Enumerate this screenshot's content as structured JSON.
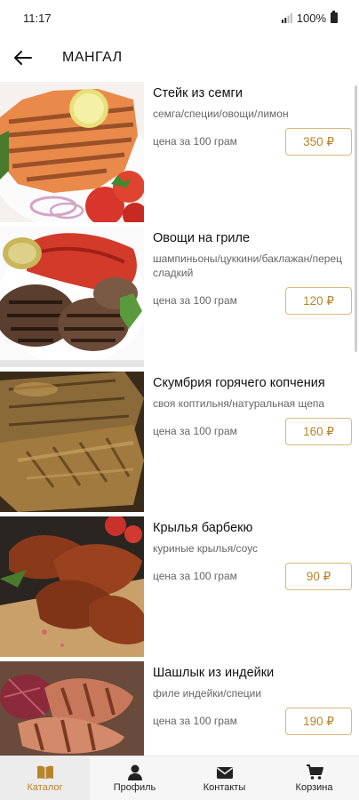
{
  "status": {
    "time": "11:17",
    "battery": "100%"
  },
  "header": {
    "title": "МАНГАЛ",
    "back_icon": "arrow-left-icon"
  },
  "items": [
    {
      "name": "Стейк из семги",
      "desc": "семга/специи/овощи/лимон",
      "price_label": "цена за 100 грам",
      "price": "350 ₽"
    },
    {
      "name": "Овощи на гриле",
      "desc": "шампиньоны/цуккини/баклажан/перец сладкий",
      "price_label": "цена за 100 грам",
      "price": "120 ₽"
    },
    {
      "name": "Скумбрия горячего копчения",
      "desc": "своя коптильня/натуральная щепа",
      "price_label": "цена за 100 грам",
      "price": "160 ₽"
    },
    {
      "name": "Крылья барбекю",
      "desc": "куриные крылья/соус",
      "price_label": "цена за 100 грам",
      "price": "90 ₽"
    },
    {
      "name": "Шашлык из индейки",
      "desc": "филе индейки/специи",
      "price_label": "цена за 100 грам",
      "price": "190 ₽"
    }
  ],
  "nav": {
    "catalog": "Каталог",
    "profile": "Профиль",
    "contacts": "Контакты",
    "cart": "Корзина"
  },
  "colors": {
    "accent": "#b8842b",
    "price_border": "#d9b97c"
  }
}
